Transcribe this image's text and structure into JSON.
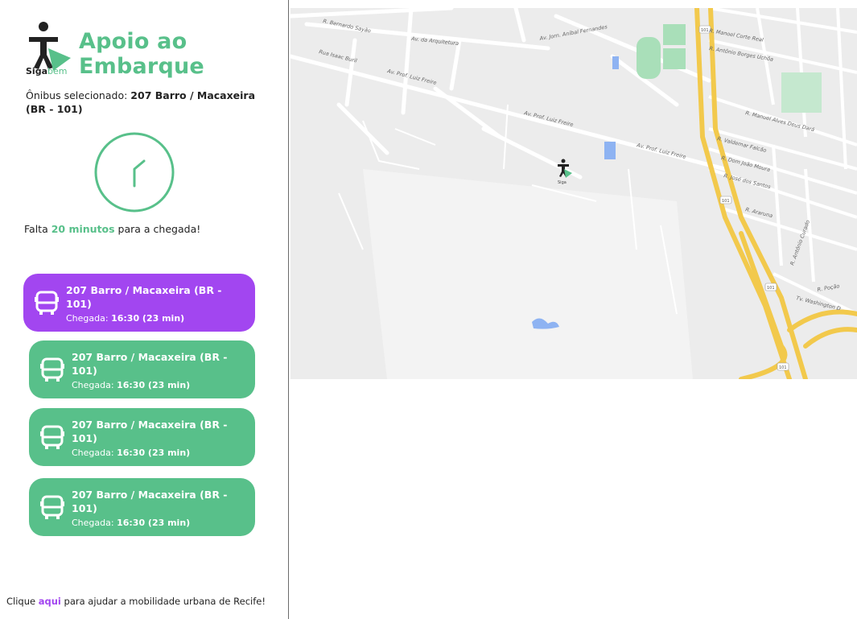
{
  "brand": {
    "logo_text_prefix": "Siga",
    "logo_text_suffix": "bem",
    "app_title": "Apoio ao Embarque",
    "primary_color": "#58c08a",
    "accent_color": "#a246f0"
  },
  "selection": {
    "prefix": "Ônibus selecionado: ",
    "bus": "207 Barro / Macaxeira (BR - 101)"
  },
  "eta": {
    "prefix": "Falta ",
    "highlight": "20 minutos",
    "suffix": " para a chegada!"
  },
  "buses": [
    {
      "title": "207 Barro / Macaxeira (BR - 101)",
      "arrival_label": "Chegada: ",
      "arrival_value": "16:30 (23 min)",
      "selected": true
    },
    {
      "title": "207 Barro / Macaxeira (BR - 101)",
      "arrival_label": "Chegada: ",
      "arrival_value": "16:30 (23 min)",
      "selected": false
    },
    {
      "title": "207 Barro / Macaxeira (BR - 101)",
      "arrival_label": "Chegada: ",
      "arrival_value": "16:30 (23 min)",
      "selected": false
    },
    {
      "title": "207 Barro / Macaxeira (BR - 101)",
      "arrival_label": "Chegada: ",
      "arrival_value": "16:30 (23 min)",
      "selected": false
    }
  ],
  "footer": {
    "prefix": "Clique ",
    "link": "aqui",
    "suffix": " para ajudar a mobilidade urbana de Recife!"
  },
  "map": {
    "streets": [
      "R. Bernardo Sayão",
      "Av. da Arquitetura",
      "Av. Jorn. Aníbal Fernandes",
      "Rua Isaac Buril",
      "Av. Prof. Luiz Freire",
      "Av. Prof. Luiz Freire",
      "Av. Prof. Luiz Freire",
      "R. Manoel Corte Real",
      "R. Antônio Borges Uchôa",
      "R. Manuel Alves Deus Dará",
      "R. Valdemar Falcão",
      "R. Dom João Moura",
      "R. José dos Santos",
      "R. Araruna",
      "R. Antônio Curado",
      "Tv. Washington D",
      "R. Poção"
    ],
    "highway_shield": "101"
  }
}
